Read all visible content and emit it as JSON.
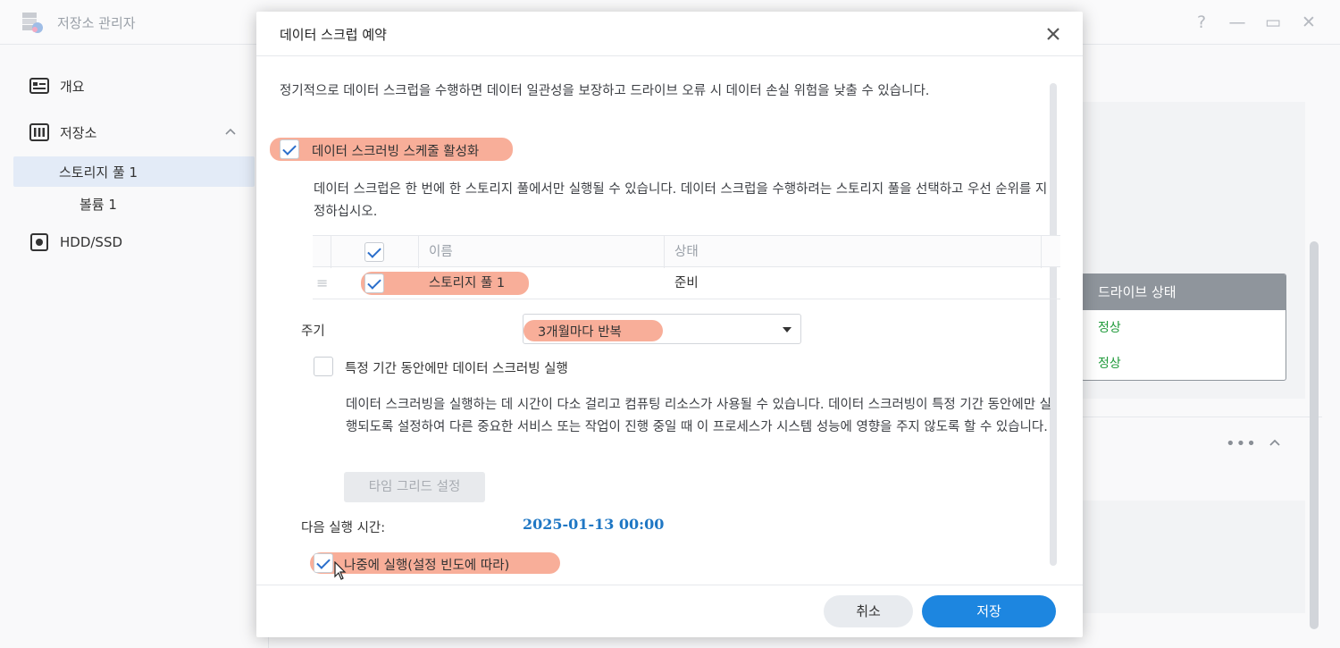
{
  "app": {
    "title": "저장소 관리자",
    "window_controls": [
      "?",
      "—",
      "▭",
      "✕"
    ]
  },
  "sidebar": {
    "items": [
      {
        "label": "개요",
        "icon": "overview-icon"
      },
      {
        "label": "저장소",
        "icon": "storage-icon"
      },
      {
        "label": "스토리지 풀 1",
        "icon": ""
      },
      {
        "label": "볼륨 1",
        "icon": ""
      },
      {
        "label": "HDD/SSD",
        "icon": "hdd-icon"
      }
    ]
  },
  "background": {
    "drive_status_header": "드라이브 상태",
    "drive_status_rows": [
      "정상",
      "정상"
    ],
    "more_label": "•••"
  },
  "modal": {
    "title": "데이터 스크럽 예약",
    "intro": "정기적으로 데이터 스크럽을 수행하면 데이터 일관성을 보장하고 드라이브 오류 시 데이터 손실 위험을 낮출 수 있습니다.",
    "enable_schedule_label": "데이터 스크러빙 스케줄 활성화",
    "scrub_desc": "데이터 스크럽은 한 번에 한 스토리지 풀에서만 실행될 수 있습니다. 데이터 스크럽을 수행하려는 스토리지 풀을 선택하고 우선 순위를 지정하십시오.",
    "table": {
      "col_name": "이름",
      "col_status": "상태",
      "rows": [
        {
          "name": "스토리지 풀 1",
          "status": "준비"
        }
      ]
    },
    "period_label": "주기",
    "period_value": "3개월마다 반복",
    "time_window_label": "특정 기간 동안에만 데이터 스크러빙 실행",
    "time_window_desc": "데이터 스크러빙을 실행하는 데 시간이 다소 걸리고 컴퓨팅 리소스가 사용될 수 있습니다. 데이터 스크러빙이 특정 기간 동안에만 실행되도록 설정하여 다른 중요한 서비스 또는 작업이 진행 중일 때 이 프로세스가 시스템 성능에 영향을 주지 않도록 할 수 있습니다.",
    "time_grid_button": "타임 그리드 설정",
    "next_run_label": "다음 실행 시간:",
    "next_run_value": "2025-01-13 00:00",
    "run_later_label": "나중에 실행(설정 빈도에 따라)",
    "cancel_button": "취소",
    "save_button": "저장"
  },
  "colors": {
    "accent": "#1d86e0",
    "highlight": "#f58c6e",
    "ok_green": "#1f9a3a"
  }
}
